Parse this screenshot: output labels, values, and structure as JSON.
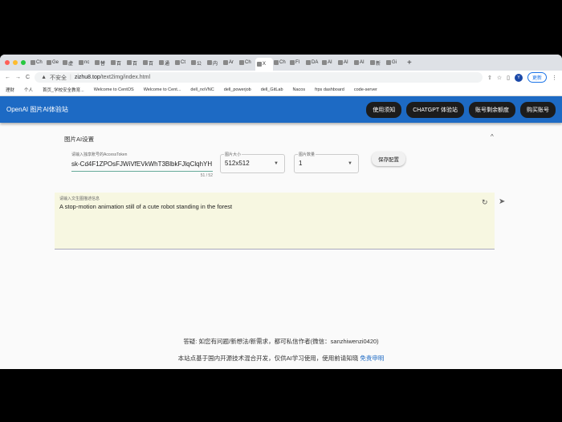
{
  "browser": {
    "tabs": [
      "Ch",
      "Ge",
      "虚",
      "nc",
      "替",
      "百",
      "百",
      "百",
      "通",
      "Ct",
      "公",
      "内",
      "Ar",
      "Ch",
      "X",
      "Ch",
      "Fl",
      "DA",
      "AI",
      "AI",
      "AI",
      "新",
      "Gi"
    ],
    "active_tab": 14,
    "new_tab": "+",
    "security": "不安全",
    "url_host": "zizhu8.top",
    "url_path": "/text2img/index.html",
    "profile": "Y",
    "update_label": "更新",
    "bookmarks": [
      "理财",
      "个人",
      "首页_学校安全教育...",
      "Welcome to CentOS",
      "Welcome to Cent...",
      "dell_noVNC",
      "dell_powerjob",
      "dell_GitLab",
      "Nacos",
      "frps dashboard",
      "code-server"
    ]
  },
  "app": {
    "title": "OpenAI 图片AI体验站",
    "nav": [
      "使用须知",
      "CHATGPT 体验站",
      "账号剩余额度",
      "购买账号"
    ]
  },
  "settings": {
    "title": "图片AI设置",
    "token_label": "请输入独享账号的AccessToken",
    "token_value": "sk-Cd4F1ZPOsFJWiVfEVkWhT3BlbkFJlqClqhYH",
    "token_count": "51 / 52",
    "size_label": "图片大小",
    "size_value": "512x512",
    "count_label": "图片数量",
    "count_value": "1",
    "save_label": "保存配置"
  },
  "prompt": {
    "label": "请输入文生图描述信息",
    "value": "A stop-motion animation still of a cute robot standing in the forest"
  },
  "footer": {
    "line1": "答疑: 如您有问题/新想法/新需求，都可私信作者(微信：sanzhiwenzi0420)",
    "line2": "本站点基于国内开源技术混合开发，仅供AI学习使用，使用前请知晓",
    "disclaimer_link": "免责申明"
  }
}
